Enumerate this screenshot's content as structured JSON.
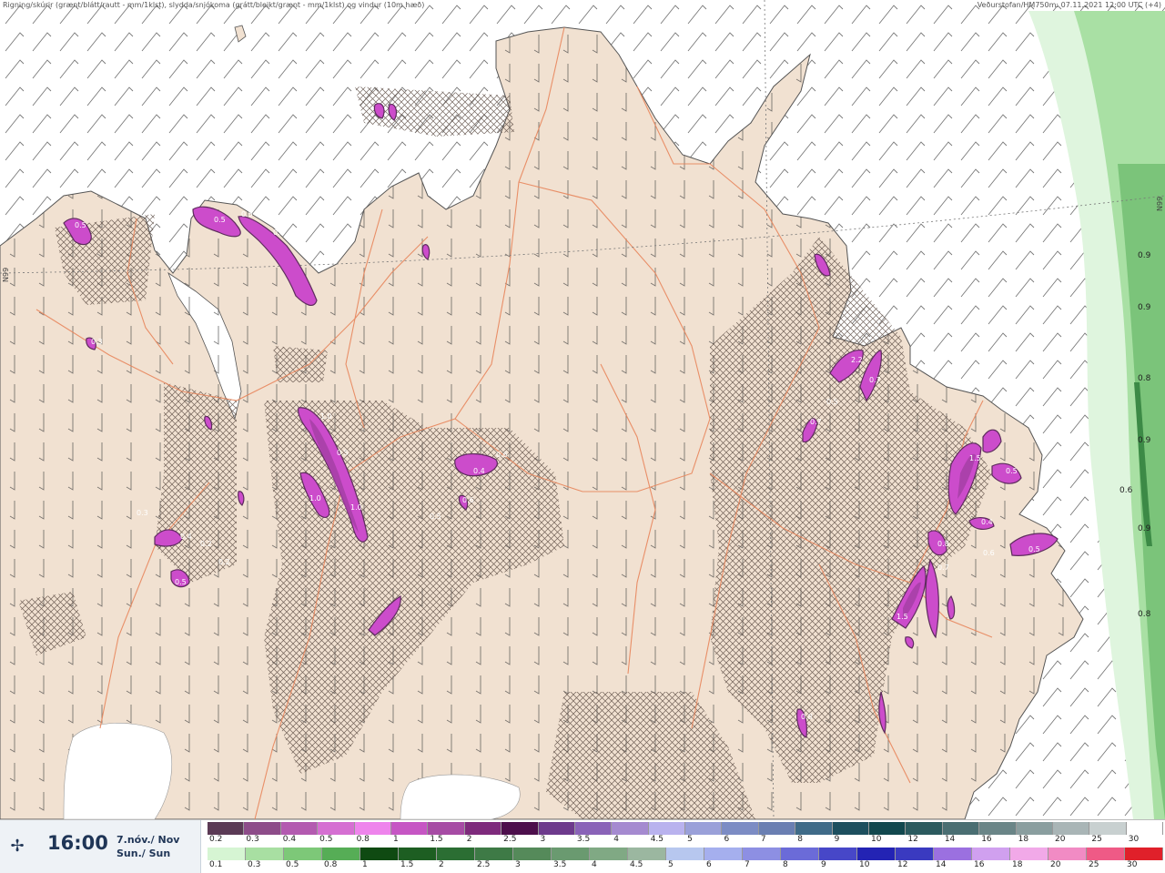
{
  "header": {
    "left": "Rigning/skúrir (grænt/blátt/rautt - mm/1klst), slydda/snjókoma (grátt/bleikt/grænt - mm/1klst) og vindur (10m hæð)",
    "right": "Veðurstofan/HM750m: 07.11.2021 12:00 UTC (+4)"
  },
  "grid_labels": {
    "left": "N99",
    "right": "N99"
  },
  "time": {
    "icon": "wind-icon",
    "value": "16:00",
    "date_is": "7.nóv./ Nov",
    "day": "Sun./ Sun"
  },
  "map_values": {
    "snow": [
      "0.5",
      "0.5",
      "0.5",
      "0.5",
      "0.3",
      "0.4",
      "0.2",
      "0.5",
      "0.2",
      "1.0",
      "0.5",
      "1.0",
      "1.0",
      "0.6",
      "0.4",
      "0.6",
      "0.5",
      "0.3",
      "2.2",
      "0.7",
      "0.5",
      "0.7",
      "1.5",
      "0.5",
      "0.4",
      "0.5",
      "0.8",
      "0.7",
      "1.5",
      "0.6",
      "0.8"
    ],
    "rain": [
      "0.9",
      "0.9",
      "0.8",
      "0.9",
      "0.6",
      "0.9",
      "0.8"
    ]
  },
  "snow_scale": {
    "labels": [
      "0.2",
      "0.3",
      "0.4",
      "0.5",
      "0.8",
      "1",
      "1.5",
      "2",
      "2.5",
      "3",
      "3.5",
      "4",
      "4.5",
      "5",
      "6",
      "7",
      "8",
      "9",
      "10",
      "12",
      "14",
      "16",
      "18",
      "20",
      "25",
      "30"
    ],
    "colors": [
      "#5b3a55",
      "#8d4c89",
      "#b35ab0",
      "#d56fd2",
      "#ee84ec",
      "#c656c4",
      "#a64ba4",
      "#7e2a7c",
      "#4d0f4c",
      "#6d3a8c",
      "#8a63b8",
      "#a58ad0",
      "#b9b2ee",
      "#9aa0d9",
      "#7c8cc4",
      "#6a7fb2",
      "#3f6b88",
      "#1d4f5e",
      "#12484e",
      "#2b5a5e",
      "#4a6e72",
      "#6a8587",
      "#8a9e9f",
      "#a9b5b6",
      "#c8d0d0",
      "#ffffff"
    ]
  },
  "rain_scale": {
    "labels": [
      "0.1",
      "0.3",
      "0.5",
      "0.8",
      "1",
      "1.5",
      "2",
      "2.5",
      "3",
      "3.5",
      "4",
      "4.5",
      "5",
      "6",
      "7",
      "8",
      "9",
      "10",
      "12",
      "14",
      "16",
      "18",
      "20",
      "25",
      "30"
    ],
    "colors": [
      "#d6f5d3",
      "#a8dfa2",
      "#7dc878",
      "#56ad56",
      "#0f4a12",
      "#1d5e22",
      "#2b6e33",
      "#3e7a46",
      "#558a5a",
      "#6a9a70",
      "#80a984",
      "#9bb7a0",
      "#b7c7ef",
      "#a5afee",
      "#8d8fe3",
      "#6b6bd8",
      "#4747c8",
      "#2323b4",
      "#3a3ac0",
      "#9b70e0",
      "#d0a0ef",
      "#f1a9e8",
      "#f18bc4",
      "#ef5a86",
      "#e0202a"
    ]
  }
}
